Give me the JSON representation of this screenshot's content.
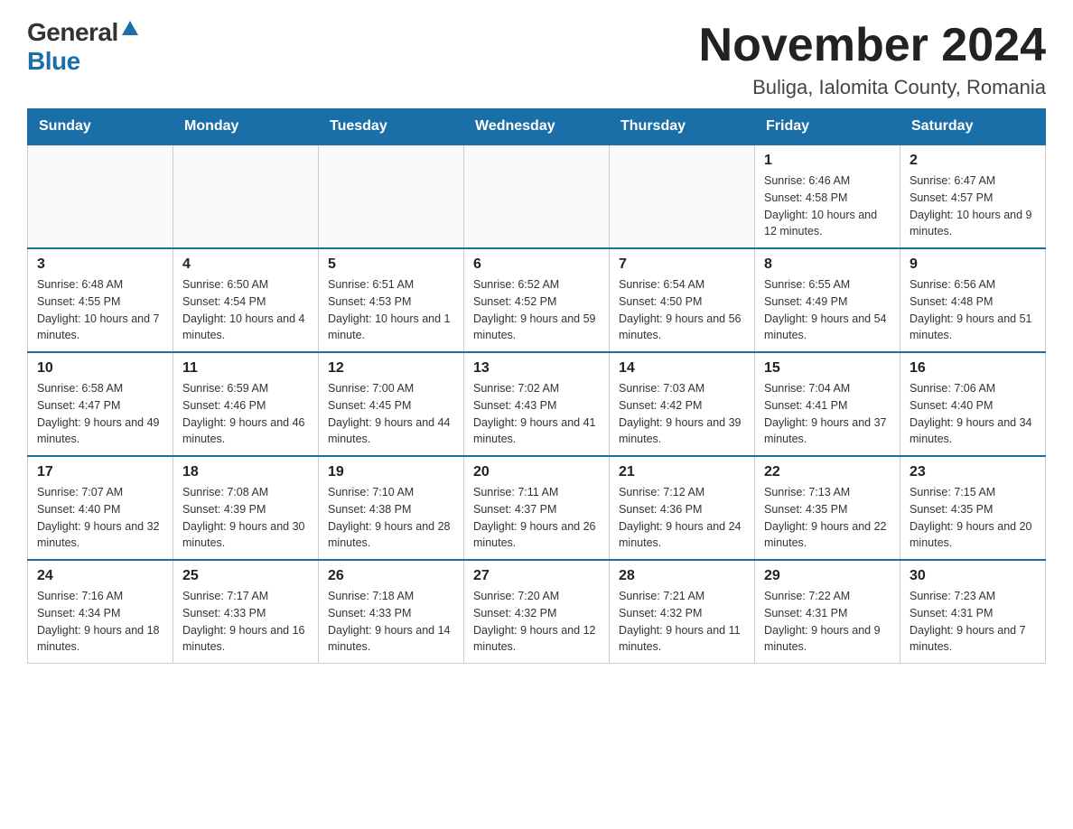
{
  "logo": {
    "general": "General",
    "blue": "Blue",
    "triangle": "▲"
  },
  "title": "November 2024",
  "location": "Buliga, Ialomita County, Romania",
  "days_of_week": [
    "Sunday",
    "Monday",
    "Tuesday",
    "Wednesday",
    "Thursday",
    "Friday",
    "Saturday"
  ],
  "weeks": [
    [
      {
        "day": "",
        "info": ""
      },
      {
        "day": "",
        "info": ""
      },
      {
        "day": "",
        "info": ""
      },
      {
        "day": "",
        "info": ""
      },
      {
        "day": "",
        "info": ""
      },
      {
        "day": "1",
        "info": "Sunrise: 6:46 AM\nSunset: 4:58 PM\nDaylight: 10 hours and 12 minutes."
      },
      {
        "day": "2",
        "info": "Sunrise: 6:47 AM\nSunset: 4:57 PM\nDaylight: 10 hours and 9 minutes."
      }
    ],
    [
      {
        "day": "3",
        "info": "Sunrise: 6:48 AM\nSunset: 4:55 PM\nDaylight: 10 hours and 7 minutes."
      },
      {
        "day": "4",
        "info": "Sunrise: 6:50 AM\nSunset: 4:54 PM\nDaylight: 10 hours and 4 minutes."
      },
      {
        "day": "5",
        "info": "Sunrise: 6:51 AM\nSunset: 4:53 PM\nDaylight: 10 hours and 1 minute."
      },
      {
        "day": "6",
        "info": "Sunrise: 6:52 AM\nSunset: 4:52 PM\nDaylight: 9 hours and 59 minutes."
      },
      {
        "day": "7",
        "info": "Sunrise: 6:54 AM\nSunset: 4:50 PM\nDaylight: 9 hours and 56 minutes."
      },
      {
        "day": "8",
        "info": "Sunrise: 6:55 AM\nSunset: 4:49 PM\nDaylight: 9 hours and 54 minutes."
      },
      {
        "day": "9",
        "info": "Sunrise: 6:56 AM\nSunset: 4:48 PM\nDaylight: 9 hours and 51 minutes."
      }
    ],
    [
      {
        "day": "10",
        "info": "Sunrise: 6:58 AM\nSunset: 4:47 PM\nDaylight: 9 hours and 49 minutes."
      },
      {
        "day": "11",
        "info": "Sunrise: 6:59 AM\nSunset: 4:46 PM\nDaylight: 9 hours and 46 minutes."
      },
      {
        "day": "12",
        "info": "Sunrise: 7:00 AM\nSunset: 4:45 PM\nDaylight: 9 hours and 44 minutes."
      },
      {
        "day": "13",
        "info": "Sunrise: 7:02 AM\nSunset: 4:43 PM\nDaylight: 9 hours and 41 minutes."
      },
      {
        "day": "14",
        "info": "Sunrise: 7:03 AM\nSunset: 4:42 PM\nDaylight: 9 hours and 39 minutes."
      },
      {
        "day": "15",
        "info": "Sunrise: 7:04 AM\nSunset: 4:41 PM\nDaylight: 9 hours and 37 minutes."
      },
      {
        "day": "16",
        "info": "Sunrise: 7:06 AM\nSunset: 4:40 PM\nDaylight: 9 hours and 34 minutes."
      }
    ],
    [
      {
        "day": "17",
        "info": "Sunrise: 7:07 AM\nSunset: 4:40 PM\nDaylight: 9 hours and 32 minutes."
      },
      {
        "day": "18",
        "info": "Sunrise: 7:08 AM\nSunset: 4:39 PM\nDaylight: 9 hours and 30 minutes."
      },
      {
        "day": "19",
        "info": "Sunrise: 7:10 AM\nSunset: 4:38 PM\nDaylight: 9 hours and 28 minutes."
      },
      {
        "day": "20",
        "info": "Sunrise: 7:11 AM\nSunset: 4:37 PM\nDaylight: 9 hours and 26 minutes."
      },
      {
        "day": "21",
        "info": "Sunrise: 7:12 AM\nSunset: 4:36 PM\nDaylight: 9 hours and 24 minutes."
      },
      {
        "day": "22",
        "info": "Sunrise: 7:13 AM\nSunset: 4:35 PM\nDaylight: 9 hours and 22 minutes."
      },
      {
        "day": "23",
        "info": "Sunrise: 7:15 AM\nSunset: 4:35 PM\nDaylight: 9 hours and 20 minutes."
      }
    ],
    [
      {
        "day": "24",
        "info": "Sunrise: 7:16 AM\nSunset: 4:34 PM\nDaylight: 9 hours and 18 minutes."
      },
      {
        "day": "25",
        "info": "Sunrise: 7:17 AM\nSunset: 4:33 PM\nDaylight: 9 hours and 16 minutes."
      },
      {
        "day": "26",
        "info": "Sunrise: 7:18 AM\nSunset: 4:33 PM\nDaylight: 9 hours and 14 minutes."
      },
      {
        "day": "27",
        "info": "Sunrise: 7:20 AM\nSunset: 4:32 PM\nDaylight: 9 hours and 12 minutes."
      },
      {
        "day": "28",
        "info": "Sunrise: 7:21 AM\nSunset: 4:32 PM\nDaylight: 9 hours and 11 minutes."
      },
      {
        "day": "29",
        "info": "Sunrise: 7:22 AM\nSunset: 4:31 PM\nDaylight: 9 hours and 9 minutes."
      },
      {
        "day": "30",
        "info": "Sunrise: 7:23 AM\nSunset: 4:31 PM\nDaylight: 9 hours and 7 minutes."
      }
    ]
  ]
}
